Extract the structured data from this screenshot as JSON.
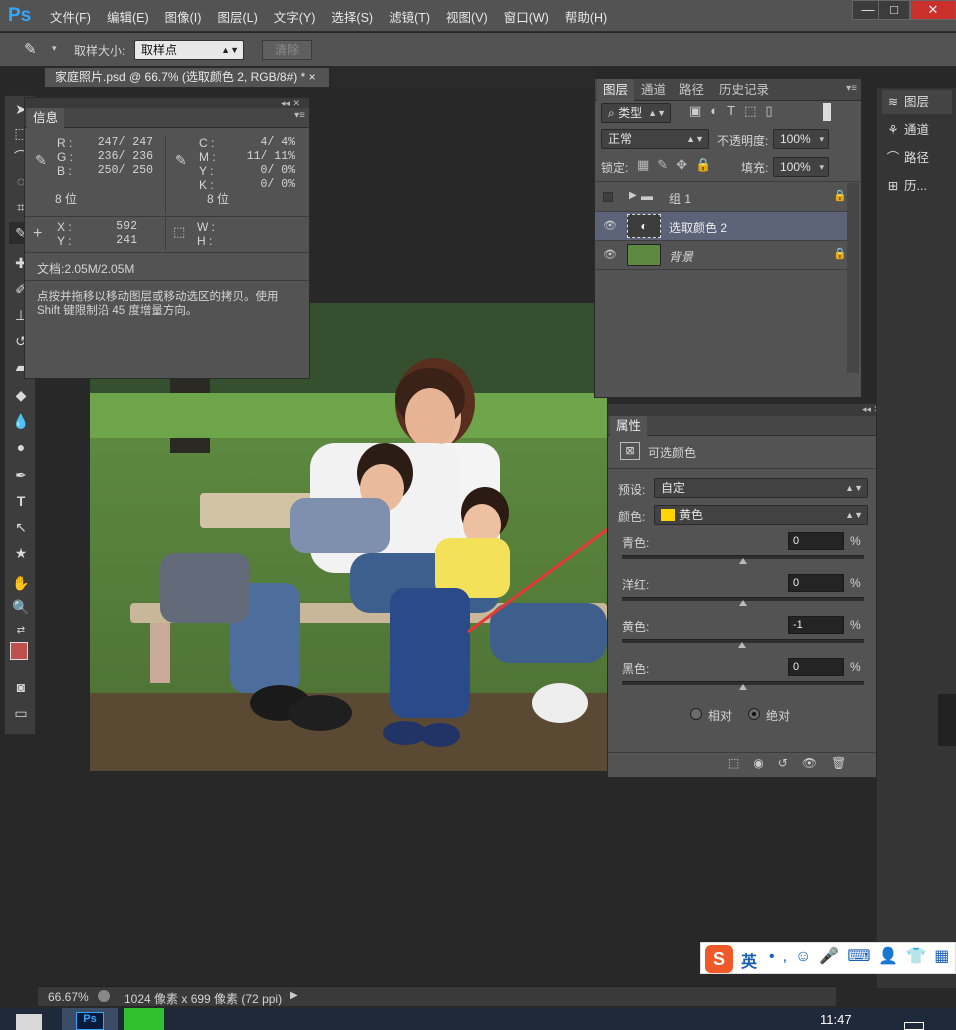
{
  "app": {
    "logo": "Ps"
  },
  "menu": [
    "文件(F)",
    "编辑(E)",
    "图像(I)",
    "图层(L)",
    "文字(Y)",
    "选择(S)",
    "滤镜(T)",
    "视图(V)",
    "窗口(W)",
    "帮助(H)"
  ],
  "window_controls": {
    "minimize": "—",
    "restore": "□",
    "close": "✕"
  },
  "options": {
    "sample_size_label": "取样大小:",
    "sample_size_value": "取样点",
    "clear_button": "清除"
  },
  "document_tab": {
    "title": "家庭照片.psd @ 66.7% (选取颜色 2, RGB/8#) *",
    "close": "×"
  },
  "info_panel": {
    "tab": "信息",
    "rgb": {
      "R": "247/ 247",
      "G": "236/ 236",
      "B": "250/ 250",
      "labels": [
        "R :",
        "G :",
        "B :"
      ]
    },
    "cmyk": {
      "labels": [
        "C :",
        "M :",
        "Y :",
        "K :"
      ],
      "C": "4/  4%",
      "M": "11/ 11%",
      "Y": "0/  0%",
      "K": "0/  0%"
    },
    "bits_left": "8 位",
    "bits_right": "8 位",
    "xy": {
      "labels": [
        "X :",
        "Y :"
      ],
      "X": "592",
      "Y": "241"
    },
    "wh": {
      "labels": [
        "W :",
        "H :"
      ]
    },
    "doc": "文档:2.05M/2.05M",
    "hint": "点按并拖移以移动图层或移动选区的拷贝。使用 Shift 键限制沿 45 度增量方向。"
  },
  "layers_panel": {
    "tabs": [
      "图层",
      "通道",
      "路径",
      "历史记录"
    ],
    "filter_kind": "类型",
    "blend_mode": "正常",
    "opacity_label": "不透明度:",
    "opacity": "100%",
    "lock_label": "锁定:",
    "fill_label": "填充:",
    "fill": "100%",
    "layers": [
      {
        "name": "组 1",
        "type": "group",
        "visible": false,
        "locked": true
      },
      {
        "name": "选取颜色 2",
        "type": "adjustment",
        "visible": true,
        "selected": true
      },
      {
        "name": "背景",
        "type": "image",
        "visible": true,
        "locked": true
      }
    ]
  },
  "properties_panel": {
    "tab": "属性",
    "title": "可选颜色",
    "preset_label": "预设:",
    "preset_value": "自定",
    "colors_label": "颜色:",
    "colors_value": "黄色",
    "colors_swatch": "#ffd400",
    "sliders": [
      {
        "label": "青色:",
        "value": "0",
        "unit": "%",
        "level": 0
      },
      {
        "label": "洋红:",
        "value": "0",
        "unit": "%",
        "level": 0
      },
      {
        "label": "黄色:",
        "value": "-1",
        "unit": "%",
        "level": -1
      },
      {
        "label": "黑色:",
        "value": "0",
        "unit": "%",
        "level": 0
      }
    ],
    "method_relative": "相对",
    "method_absolute": "绝对",
    "method_selected": "绝对"
  },
  "dock": [
    "图层",
    "通道",
    "路径",
    "历..."
  ],
  "status": {
    "zoom": "66.67%",
    "doc_info": "1024 像素 x 699 像素 (72 ppi)"
  },
  "ime": {
    "mode": "英"
  },
  "clock": "11:47",
  "colors": {
    "foreground": "#c0504d",
    "background": "#cc1111",
    "accent_arrow": "#e53935"
  }
}
